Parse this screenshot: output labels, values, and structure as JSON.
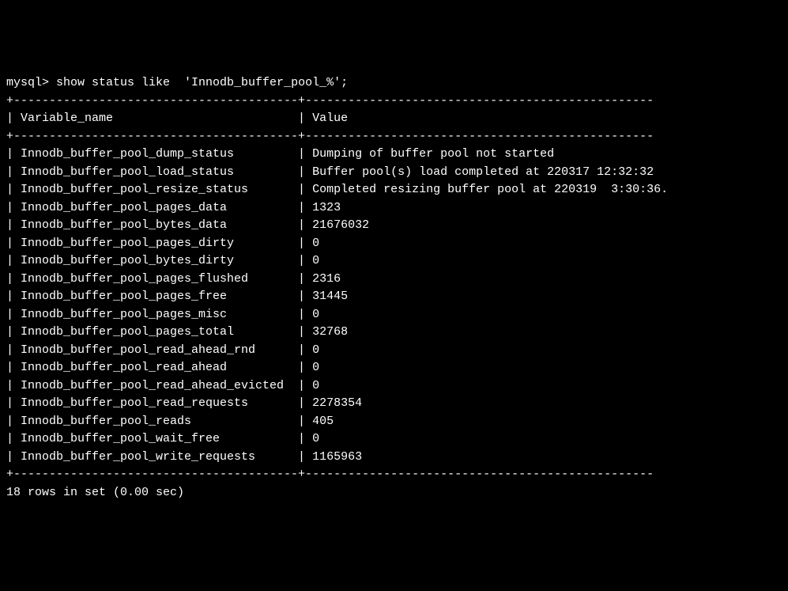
{
  "prompt": "mysql> ",
  "command": "show status like  'Innodb_buffer_pool_%';",
  "header_separator_top": "+----------------------------------------+-------------------------------------------------",
  "header_row": "| Variable_name                          | Value",
  "header_separator_bottom": "+----------------------------------------+-------------------------------------------------",
  "rows": [
    {
      "name": "Innodb_buffer_pool_dump_status",
      "value": "Dumping of buffer pool not started"
    },
    {
      "name": "Innodb_buffer_pool_load_status",
      "value": "Buffer pool(s) load completed at 220317 12:32:32"
    },
    {
      "name": "Innodb_buffer_pool_resize_status",
      "value": "Completed resizing buffer pool at 220319  3:30:36."
    },
    {
      "name": "Innodb_buffer_pool_pages_data",
      "value": "1323"
    },
    {
      "name": "Innodb_buffer_pool_bytes_data",
      "value": "21676032"
    },
    {
      "name": "Innodb_buffer_pool_pages_dirty",
      "value": "0"
    },
    {
      "name": "Innodb_buffer_pool_bytes_dirty",
      "value": "0"
    },
    {
      "name": "Innodb_buffer_pool_pages_flushed",
      "value": "2316"
    },
    {
      "name": "Innodb_buffer_pool_pages_free",
      "value": "31445"
    },
    {
      "name": "Innodb_buffer_pool_pages_misc",
      "value": "0"
    },
    {
      "name": "Innodb_buffer_pool_pages_total",
      "value": "32768"
    },
    {
      "name": "Innodb_buffer_pool_read_ahead_rnd",
      "value": "0"
    },
    {
      "name": "Innodb_buffer_pool_read_ahead",
      "value": "0"
    },
    {
      "name": "Innodb_buffer_pool_read_ahead_evicted",
      "value": "0"
    },
    {
      "name": "Innodb_buffer_pool_read_requests",
      "value": "2278354"
    },
    {
      "name": "Innodb_buffer_pool_reads",
      "value": "405"
    },
    {
      "name": "Innodb_buffer_pool_wait_free",
      "value": "0"
    },
    {
      "name": "Innodb_buffer_pool_write_requests",
      "value": "1165963"
    }
  ],
  "footer_separator": "+----------------------------------------+-------------------------------------------------",
  "footer_text": "18 rows in set (0.00 sec)",
  "col1_width": 38
}
